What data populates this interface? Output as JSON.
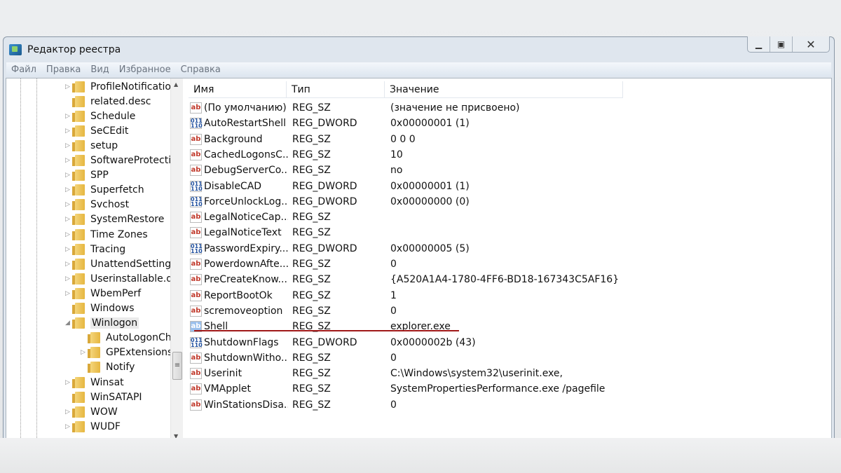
{
  "window": {
    "title": "Редактор реестра",
    "controls": [
      "minimize",
      "maximize",
      "close"
    ]
  },
  "menu": [
    "Файл",
    "Правка",
    "Вид",
    "Избранное",
    "Справка"
  ],
  "tree": [
    {
      "label": "ProfileNotificatio",
      "level": 0,
      "expander": true
    },
    {
      "label": "related.desc",
      "level": 0,
      "expander": false
    },
    {
      "label": "Schedule",
      "level": 0,
      "expander": true
    },
    {
      "label": "SeCEdit",
      "level": 0,
      "expander": true
    },
    {
      "label": "setup",
      "level": 0,
      "expander": true
    },
    {
      "label": "SoftwareProtectic",
      "level": 0,
      "expander": true
    },
    {
      "label": "SPP",
      "level": 0,
      "expander": true
    },
    {
      "label": "Superfetch",
      "level": 0,
      "expander": true
    },
    {
      "label": "Svchost",
      "level": 0,
      "expander": true
    },
    {
      "label": "SystemRestore",
      "level": 0,
      "expander": true
    },
    {
      "label": "Time Zones",
      "level": 0,
      "expander": true
    },
    {
      "label": "Tracing",
      "level": 0,
      "expander": true
    },
    {
      "label": "UnattendSettings",
      "level": 0,
      "expander": true
    },
    {
      "label": "Userinstallable.dr",
      "level": 0,
      "expander": true
    },
    {
      "label": "WbemPerf",
      "level": 0,
      "expander": true
    },
    {
      "label": "Windows",
      "level": 0,
      "expander": false
    },
    {
      "label": "Winlogon",
      "level": 0,
      "expander": true,
      "expanded": true,
      "selected": true
    },
    {
      "label": "AutoLogonCh",
      "level": 1,
      "expander": false
    },
    {
      "label": "GPExtensions",
      "level": 1,
      "expander": true
    },
    {
      "label": "Notify",
      "level": 1,
      "expander": false
    },
    {
      "label": "Winsat",
      "level": 0,
      "expander": true
    },
    {
      "label": "WinSATAPI",
      "level": 0,
      "expander": false
    },
    {
      "label": "WOW",
      "level": 0,
      "expander": true
    },
    {
      "label": "WUDF",
      "level": 0,
      "expander": true
    }
  ],
  "columns": {
    "name": "Имя",
    "type": "Тип",
    "value": "Значение"
  },
  "rows": [
    {
      "name": "(По умолчанию)",
      "type": "REG_SZ",
      "value": "(значение не присвоено)"
    },
    {
      "name": "AutoRestartShell",
      "type": "REG_DWORD",
      "value": "0x00000001 (1)"
    },
    {
      "name": "Background",
      "type": "REG_SZ",
      "value": "0 0 0"
    },
    {
      "name": "CachedLogonsC...",
      "type": "REG_SZ",
      "value": "10"
    },
    {
      "name": "DebugServerCo...",
      "type": "REG_SZ",
      "value": "no"
    },
    {
      "name": "DisableCAD",
      "type": "REG_DWORD",
      "value": "0x00000001 (1)"
    },
    {
      "name": "ForceUnlockLog...",
      "type": "REG_DWORD",
      "value": "0x00000000 (0)"
    },
    {
      "name": "LegalNoticeCap...",
      "type": "REG_SZ",
      "value": ""
    },
    {
      "name": "LegalNoticeText",
      "type": "REG_SZ",
      "value": ""
    },
    {
      "name": "PasswordExpiry...",
      "type": "REG_DWORD",
      "value": "0x00000005 (5)"
    },
    {
      "name": "PowerdownAfte...",
      "type": "REG_SZ",
      "value": "0"
    },
    {
      "name": "PreCreateKnow...",
      "type": "REG_SZ",
      "value": "{A520A1A4-1780-4FF6-BD18-167343C5AF16}"
    },
    {
      "name": "ReportBootOk",
      "type": "REG_SZ",
      "value": "1"
    },
    {
      "name": "scremoveoption",
      "type": "REG_SZ",
      "value": "0"
    },
    {
      "name": "Shell",
      "type": "REG_SZ",
      "value": "explorer.exe",
      "highlighted": true
    },
    {
      "name": "ShutdownFlags",
      "type": "REG_DWORD",
      "value": "0x0000002b (43)"
    },
    {
      "name": "ShutdownWitho...",
      "type": "REG_SZ",
      "value": "0"
    },
    {
      "name": "Userinit",
      "type": "REG_SZ",
      "value": "C:\\Windows\\system32\\userinit.exe,"
    },
    {
      "name": "VMApplet",
      "type": "REG_SZ",
      "value": "SystemPropertiesPerformance.exe /pagefile"
    },
    {
      "name": "WinStationsDisa...",
      "type": "REG_SZ",
      "value": "0"
    }
  ],
  "icons": {
    "REG_SZ": "ab",
    "REG_DWORD": "011\n110"
  },
  "colors": {
    "highlight_underline": "#a01818"
  }
}
